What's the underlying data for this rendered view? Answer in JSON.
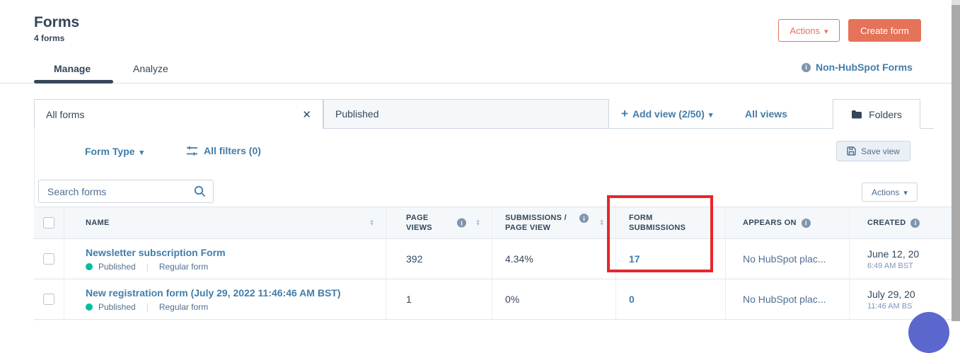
{
  "page": {
    "title": "Forms",
    "count": "4 forms"
  },
  "header": {
    "actions_button": "Actions",
    "create_form_button": "Create form",
    "non_hubspot_link": "Non-HubSpot Forms"
  },
  "tabs": [
    {
      "label": "Manage",
      "active": true
    },
    {
      "label": "Analyze",
      "active": false
    }
  ],
  "views_bar": {
    "active_view": "All forms",
    "second_view": "Published",
    "add_view": "Add view (2/50)",
    "all_views": "All views",
    "folders": "Folders"
  },
  "filter_row": {
    "form_type": "Form Type",
    "all_filters": "All filters (0)",
    "save_view": "Save view"
  },
  "search": {
    "placeholder": "Search forms"
  },
  "table_toolbar": {
    "actions_button": "Actions"
  },
  "table": {
    "columns": [
      {
        "label": "NAME",
        "sortable": true,
        "info": false
      },
      {
        "label": "PAGE VIEWS",
        "sortable": true,
        "info": true
      },
      {
        "label": "SUBMISSIONS / PAGE VIEW",
        "sortable": true,
        "info": true
      },
      {
        "label": "FORM SUBMISSIONS",
        "sortable": true,
        "info": false
      },
      {
        "label": "APPEARS ON",
        "sortable": false,
        "info": true
      },
      {
        "label": "CREATED",
        "sortable": false,
        "info": true
      }
    ],
    "rows": [
      {
        "name": "Newsletter subscription Form",
        "status": "Published",
        "type": "Regular form",
        "page_views": "392",
        "submissions_per_page_view": "4.34%",
        "form_submissions": "17",
        "appears_on": "No HubSpot plac...",
        "created_date": "June 12, 20",
        "created_time": "6:49 AM BST"
      },
      {
        "name": "New registration form (July 29, 2022 11:46:46 AM BST)",
        "status": "Published",
        "type": "Regular form",
        "page_views": "1",
        "submissions_per_page_view": "0%",
        "form_submissions": "0",
        "appears_on": "No HubSpot plac...",
        "created_date": "July 29, 20",
        "created_time": "11:46 AM BS"
      }
    ]
  },
  "annotation": {
    "highlighted_column": "FORM SUBMISSIONS",
    "highlighted_value": "17"
  },
  "colors": {
    "accent_orange": "#e5735a",
    "link_blue": "#417daa",
    "navy_text": "#33475b",
    "status_green": "#00bda5",
    "highlight_red": "#e8262a",
    "widget_purple": "#5b67cd",
    "header_bg": "#f5f8fa"
  }
}
